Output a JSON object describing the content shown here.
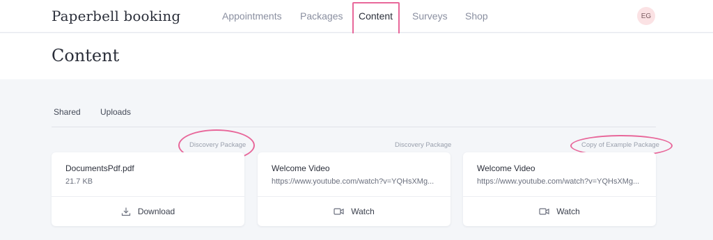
{
  "header": {
    "brand": "Paperbell booking",
    "nav": [
      {
        "label": "Appointments",
        "active": false
      },
      {
        "label": "Packages",
        "active": false
      },
      {
        "label": "Content",
        "active": true
      },
      {
        "label": "Surveys",
        "active": false
      },
      {
        "label": "Shop",
        "active": false
      }
    ],
    "avatar_initials": "EG"
  },
  "page": {
    "title": "Content"
  },
  "tabs": [
    {
      "label": "Shared",
      "active": true
    },
    {
      "label": "Uploads",
      "active": false
    }
  ],
  "cards": [
    {
      "package": "Discovery Package",
      "title": "DocumentsPdf.pdf",
      "subtitle": "21.7 KB",
      "action_label": "Download",
      "action_icon": "download-icon"
    },
    {
      "package": "Discovery Package",
      "title": "Welcome Video",
      "subtitle": "https://www.youtube.com/watch?v=YQHsXMg...",
      "action_label": "Watch",
      "action_icon": "video-camera-icon"
    },
    {
      "package": "Copy of Example Package",
      "title": "Welcome Video",
      "subtitle": "https://www.youtube.com/watch?v=YQHsXMg...",
      "action_label": "Watch",
      "action_icon": "video-camera-icon"
    }
  ],
  "colors": {
    "annotation": "#e8679a",
    "background": "#f4f6f9",
    "text": "#2b2f3a",
    "muted": "#8a8fa0",
    "avatar_bg": "#fbe2e4"
  }
}
